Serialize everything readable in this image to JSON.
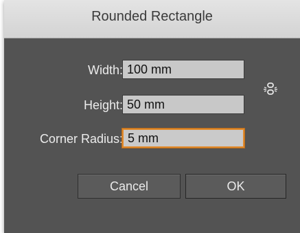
{
  "dialog": {
    "title": "Rounded Rectangle",
    "fields": {
      "width": {
        "label": "Width:",
        "value": "100 mm"
      },
      "height": {
        "label": "Height:",
        "value": "50 mm"
      },
      "corner_radius": {
        "label": "Corner Radius:",
        "value": "5 mm"
      }
    },
    "constrain_icon": "chain-link-broken-icon",
    "buttons": {
      "cancel": "Cancel",
      "ok": "OK"
    },
    "colors": {
      "panel": "#535353",
      "focus_ring": "#e08a2c"
    }
  }
}
